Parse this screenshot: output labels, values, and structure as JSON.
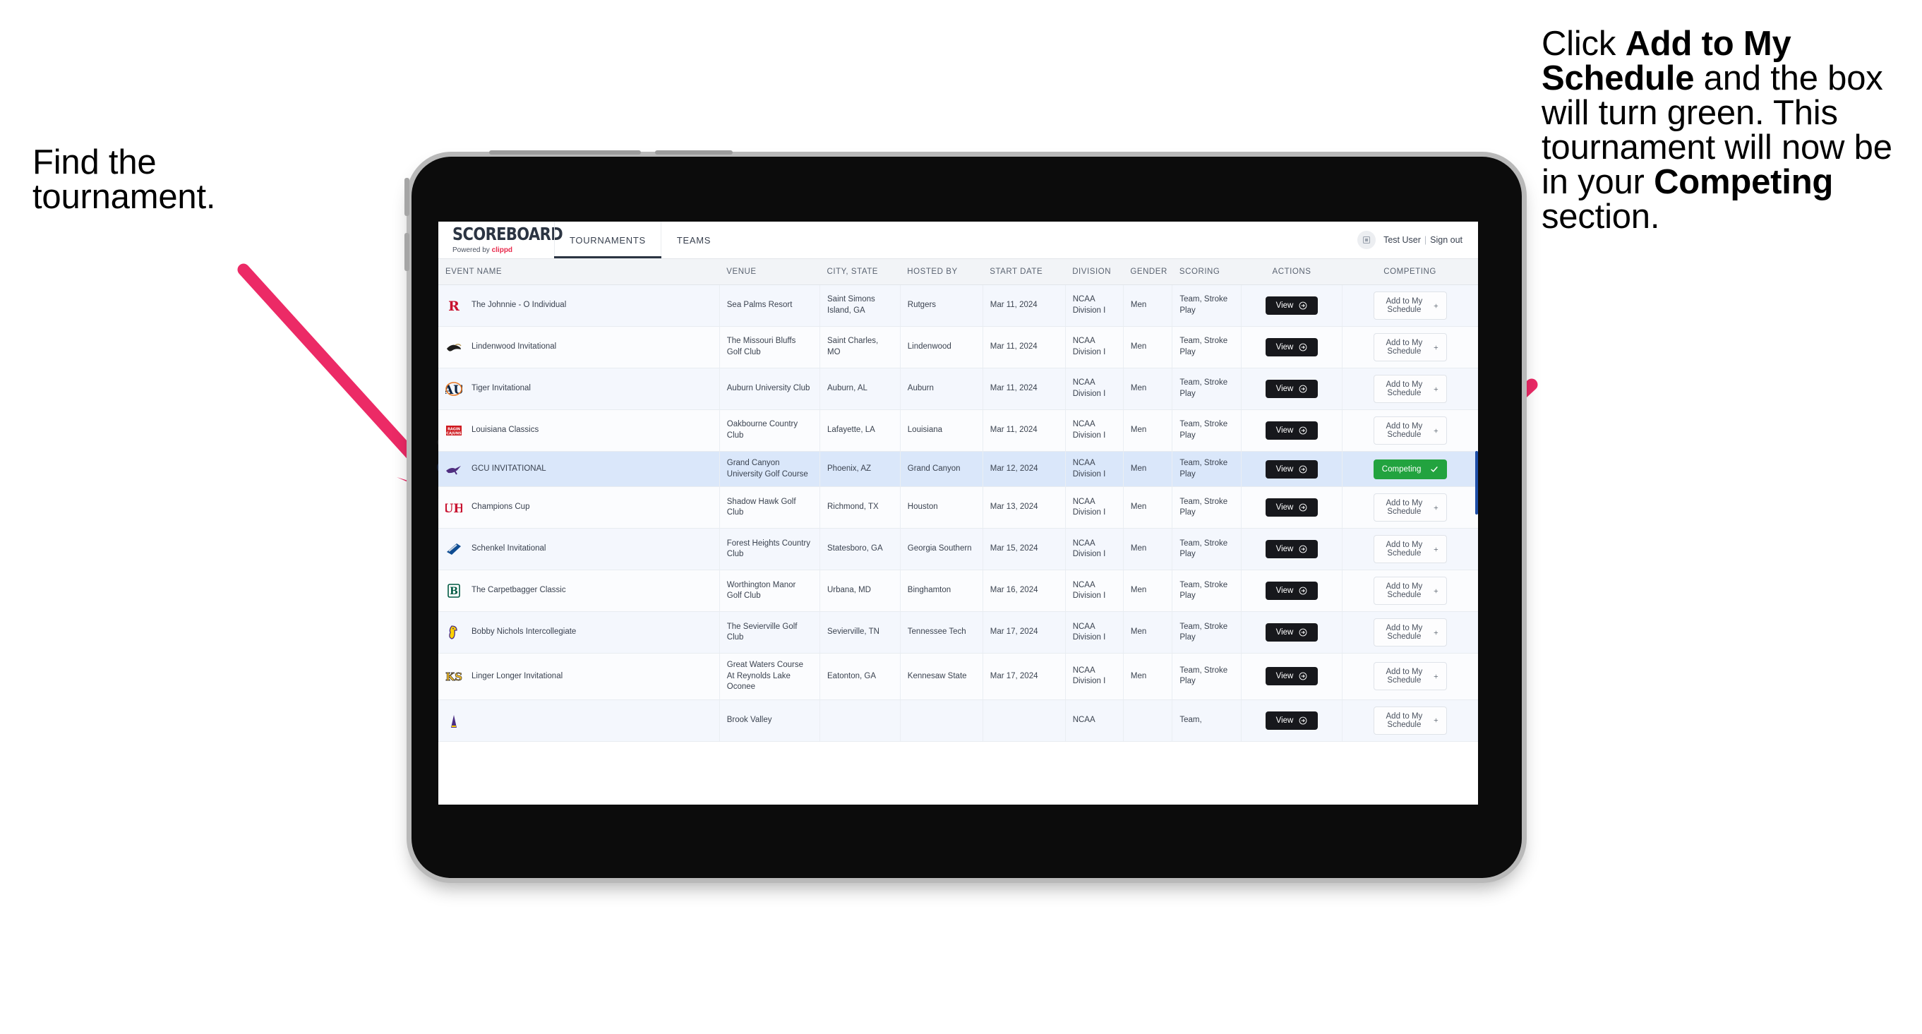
{
  "annotations": {
    "left": {
      "line1": "Find the",
      "line2": "tournament."
    },
    "right": {
      "pre": "Click ",
      "bold1": "Add to My Schedule",
      "mid": " and the box will turn green. This tournament will now be in your ",
      "bold2": "Competing",
      "post": " section."
    }
  },
  "app": {
    "brand": {
      "title": "SCOREBOARD",
      "powered_prefix": "Powered by ",
      "powered_brand": "clippd"
    },
    "tabs": [
      {
        "label": "TOURNAMENTS",
        "active": true
      },
      {
        "label": "TEAMS",
        "active": false
      }
    ],
    "account": {
      "avatar_icon": "user-placeholder-icon",
      "user": "Test User",
      "separator": "|",
      "sign_out": "Sign out"
    }
  },
  "table": {
    "columns": [
      "EVENT NAME",
      "VENUE",
      "CITY, STATE",
      "HOSTED BY",
      "START DATE",
      "DIVISION",
      "GENDER",
      "SCORING",
      "ACTIONS",
      "COMPETING"
    ],
    "buttons": {
      "view": "View",
      "add": "Add to My Schedule",
      "competing": "Competing"
    },
    "icons": {
      "view": "arrow-right-circle-icon",
      "add": "plus-icon",
      "competing": "check-icon"
    },
    "rows": [
      {
        "logo": "rutgers-logo",
        "event": "The Johnnie - O Individual",
        "venue": "Sea Palms Resort",
        "city": "Saint Simons Island, GA",
        "host": "Rutgers",
        "date": "Mar 11, 2024",
        "division": "NCAA Division I",
        "gender": "Men",
        "scoring": "Team, Stroke Play",
        "competing": false
      },
      {
        "logo": "lindenwood-logo",
        "event": "Lindenwood Invitational",
        "venue": "The Missouri Bluffs Golf Club",
        "city": "Saint Charles, MO",
        "host": "Lindenwood",
        "date": "Mar 11, 2024",
        "division": "NCAA Division I",
        "gender": "Men",
        "scoring": "Team, Stroke Play",
        "competing": false
      },
      {
        "logo": "auburn-logo",
        "event": "Tiger Invitational",
        "venue": "Auburn University Club",
        "city": "Auburn, AL",
        "host": "Auburn",
        "date": "Mar 11, 2024",
        "division": "NCAA Division I",
        "gender": "Men",
        "scoring": "Team, Stroke Play",
        "competing": false
      },
      {
        "logo": "louisiana-logo",
        "event": "Louisiana Classics",
        "venue": "Oakbourne Country Club",
        "city": "Lafayette, LA",
        "host": "Louisiana",
        "date": "Mar 11, 2024",
        "division": "NCAA Division I",
        "gender": "Men",
        "scoring": "Team, Stroke Play",
        "competing": false
      },
      {
        "logo": "grand-canyon-logo",
        "event": "GCU INVITATIONAL",
        "venue": "Grand Canyon University Golf Course",
        "city": "Phoenix, AZ",
        "host": "Grand Canyon",
        "date": "Mar 12, 2024",
        "division": "NCAA Division I",
        "gender": "Men",
        "scoring": "Team, Stroke Play",
        "competing": true
      },
      {
        "logo": "houston-logo",
        "event": "Champions Cup",
        "venue": "Shadow Hawk Golf Club",
        "city": "Richmond, TX",
        "host": "Houston",
        "date": "Mar 13, 2024",
        "division": "NCAA Division I",
        "gender": "Men",
        "scoring": "Team, Stroke Play",
        "competing": false
      },
      {
        "logo": "georgia-southern-logo",
        "event": "Schenkel Invitational",
        "venue": "Forest Heights Country Club",
        "city": "Statesboro, GA",
        "host": "Georgia Southern",
        "date": "Mar 15, 2024",
        "division": "NCAA Division I",
        "gender": "Men",
        "scoring": "Team, Stroke Play",
        "competing": false
      },
      {
        "logo": "binghamton-logo",
        "event": "The Carpetbagger Classic",
        "venue": "Worthington Manor Golf Club",
        "city": "Urbana, MD",
        "host": "Binghamton",
        "date": "Mar 16, 2024",
        "division": "NCAA Division I",
        "gender": "Men",
        "scoring": "Team, Stroke Play",
        "competing": false
      },
      {
        "logo": "tennessee-tech-logo",
        "event": "Bobby Nichols Intercollegiate",
        "venue": "The Sevierville Golf Club",
        "city": "Sevierville, TN",
        "host": "Tennessee Tech",
        "date": "Mar 17, 2024",
        "division": "NCAA Division I",
        "gender": "Men",
        "scoring": "Team, Stroke Play",
        "competing": false
      },
      {
        "logo": "kennesaw-state-logo",
        "event": "Linger Longer Invitational",
        "venue": "Great Waters Course At Reynolds Lake Oconee",
        "city": "Eatonton, GA",
        "host": "Kennesaw State",
        "date": "Mar 17, 2024",
        "division": "NCAA Division I",
        "gender": "Men",
        "scoring": "Team, Stroke Play",
        "competing": false
      },
      {
        "logo": "partial-logo",
        "event": "",
        "venue": "Brook Valley",
        "city": "",
        "host": "",
        "date": "",
        "division": "NCAA",
        "gender": "",
        "scoring": "Team,",
        "competing": false
      }
    ]
  },
  "colors": {
    "accent_pink": "#ec2a66",
    "competing_green": "#22a33f",
    "brand_red": "#e8294b",
    "selected_row": "#dae7fa",
    "dark_button": "#17181c"
  }
}
